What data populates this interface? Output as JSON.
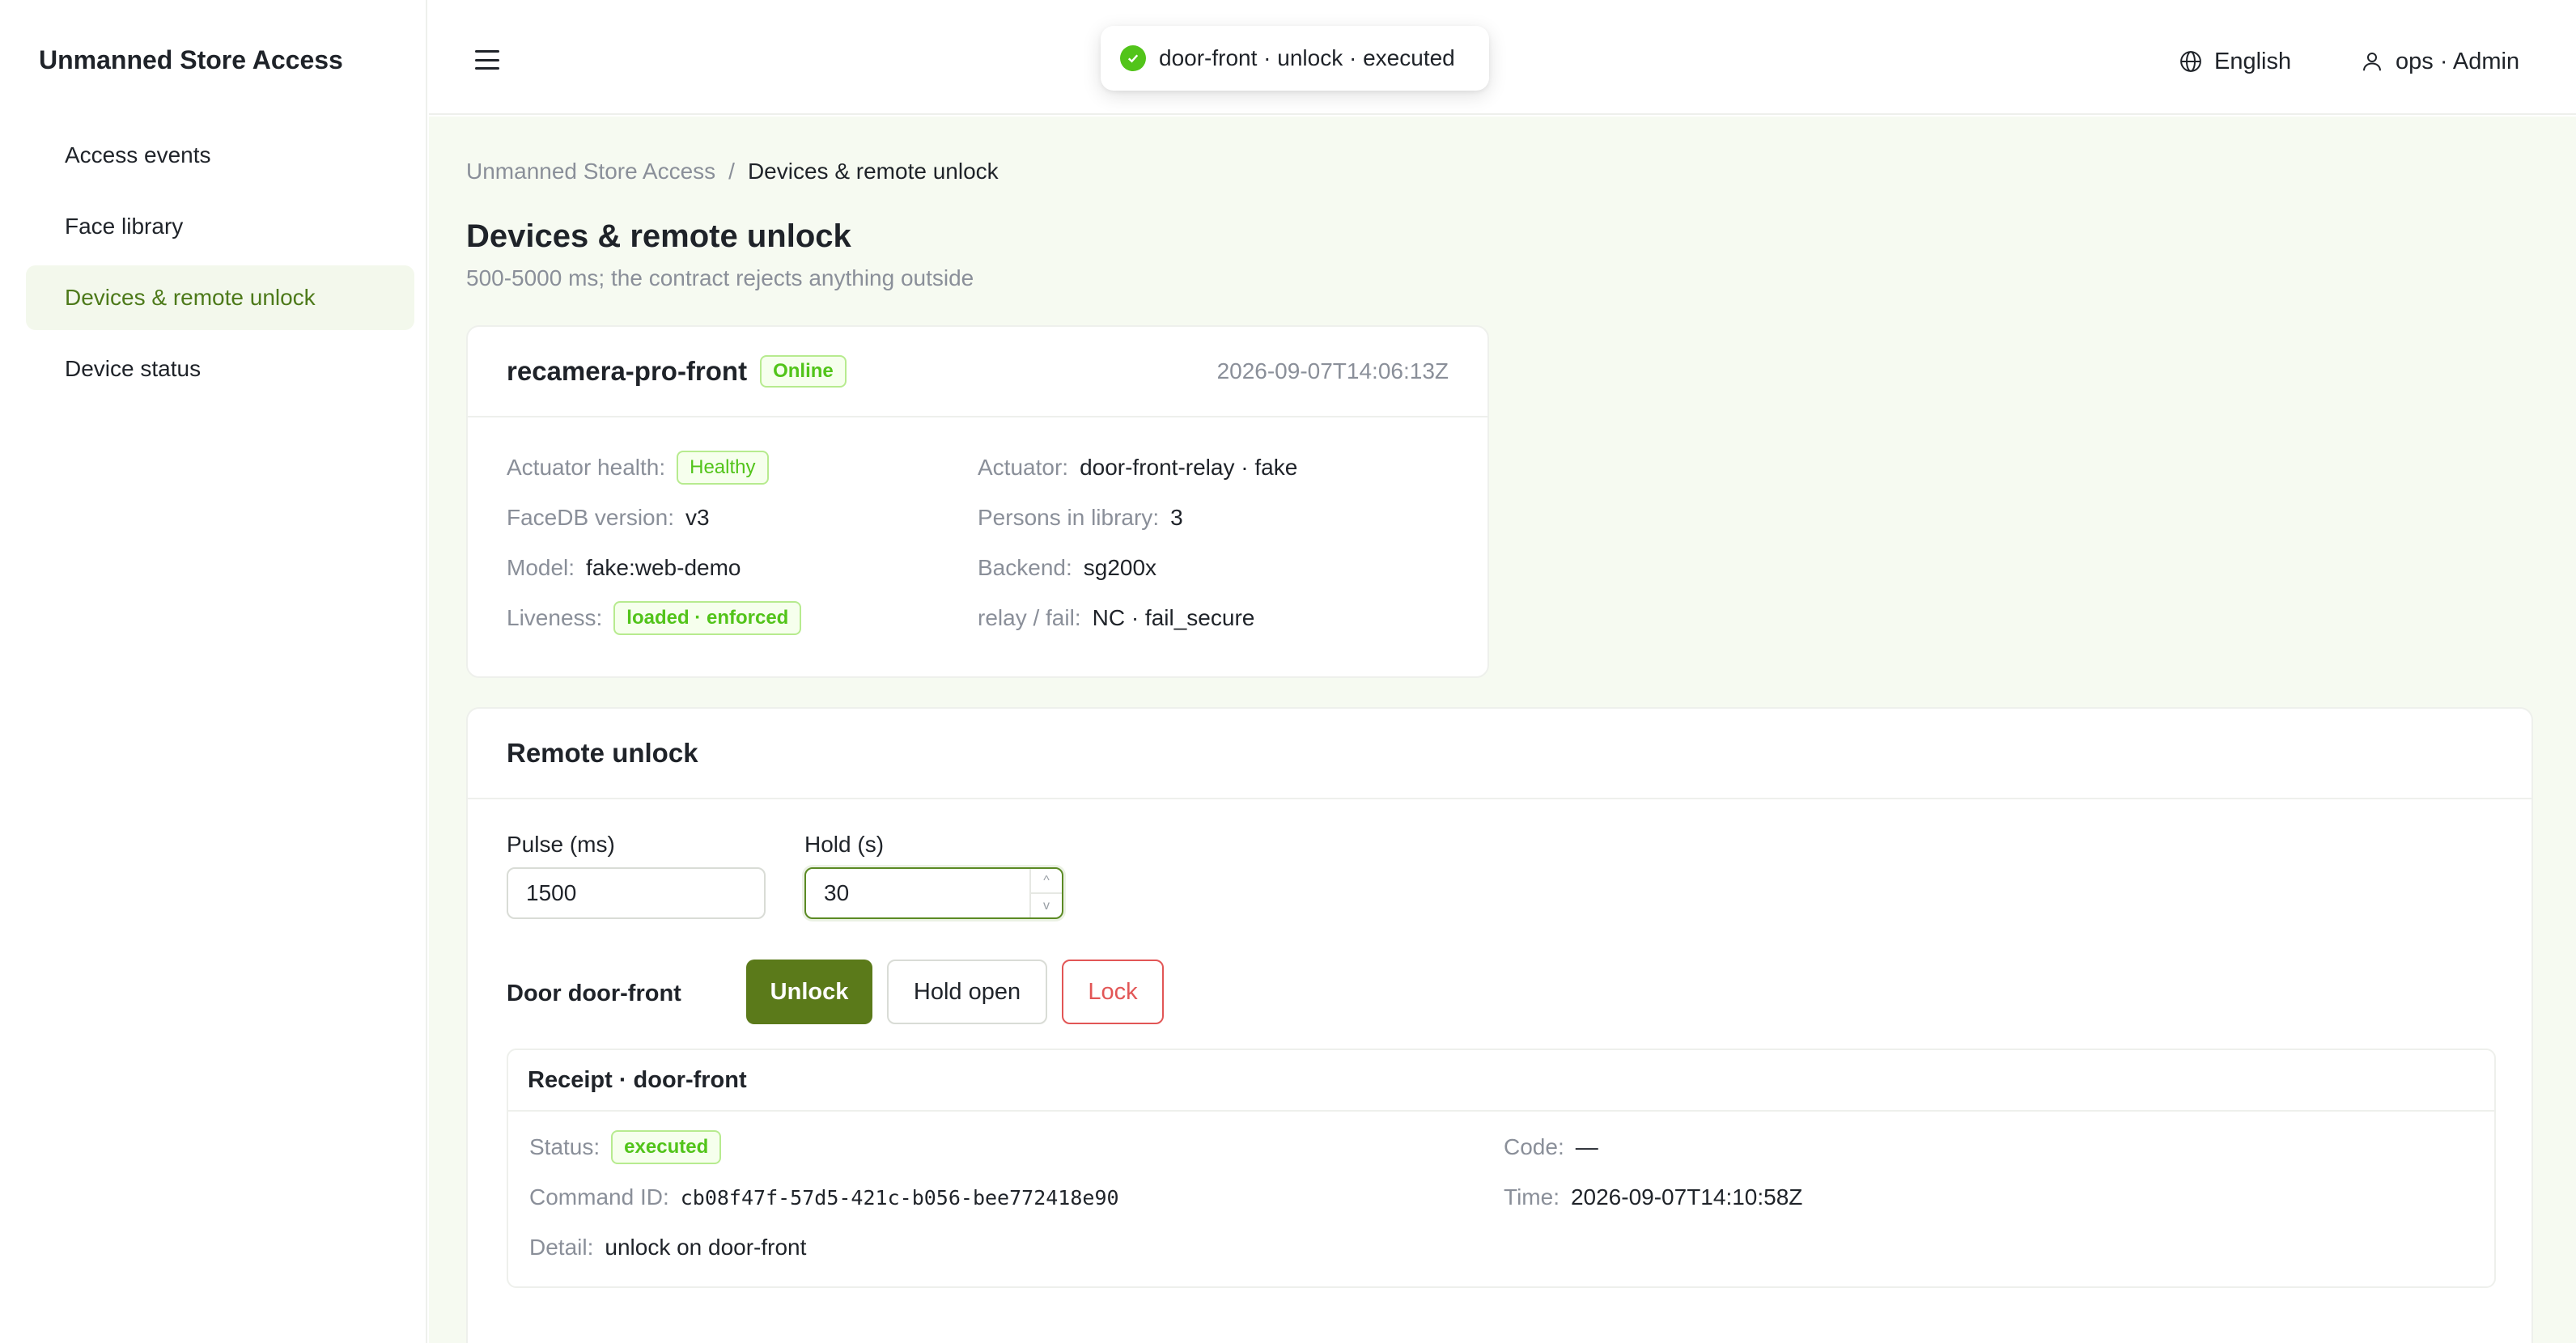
{
  "sidebar": {
    "brand": "Unmanned Store Access",
    "items": [
      {
        "label": "Access events"
      },
      {
        "label": "Face library"
      },
      {
        "label": "Devices & remote unlock"
      },
      {
        "label": "Device status"
      }
    ]
  },
  "header": {
    "language": "English",
    "user": "ops · Admin"
  },
  "toast": {
    "message": "door-front · unlock · executed"
  },
  "breadcrumb": {
    "root": "Unmanned Store Access",
    "separator": "/",
    "current": "Devices & remote unlock"
  },
  "page": {
    "title": "Devices & remote unlock",
    "subtitle": "500-5000 ms; the contract rejects anything outside"
  },
  "device": {
    "name": "recamera-pro-front",
    "status": "Online",
    "timestamp": "2026-09-07T14:06:13Z",
    "actuator_health_label": "Actuator health",
    "actuator_health": "Healthy",
    "actuator_label": "Actuator",
    "actuator": "door-front-relay · fake",
    "facedb_label": "FaceDB version",
    "facedb": "v3",
    "persons_label": "Persons in library",
    "persons": "3",
    "model_label": "Model",
    "model": "fake:web-demo",
    "backend_label": "Backend",
    "backend": "sg200x",
    "liveness_label": "Liveness",
    "liveness": "loaded · enforced",
    "relay_label": "relay / fail",
    "relay": "NC · fail_secure"
  },
  "remote": {
    "title": "Remote unlock",
    "pulse_label": "Pulse (ms)",
    "pulse_value": "1500",
    "hold_label": "Hold (s)",
    "hold_value": "30",
    "stepper_up": "^",
    "stepper_down": "v",
    "door_label": "Door door-front",
    "unlock_label": "Unlock",
    "hold_open_label": "Hold open",
    "lock_label": "Lock"
  },
  "receipt": {
    "title": "Receipt · door-front",
    "status_label": "Status",
    "status": "executed",
    "code_label": "Code",
    "code": "—",
    "command_label": "Command ID",
    "command_id": "cb08f47f-57d5-421c-b056-bee772418e90",
    "time_label": "Time",
    "time": "2026-09-07T14:10:58Z",
    "detail_label": "Detail",
    "detail": "unlock on door-front",
    "colon": ":"
  },
  "colors": {
    "accent": "#5b7a1a",
    "success": "#52c41a",
    "danger": "#e25656",
    "content_bg": "#f6faf1"
  }
}
